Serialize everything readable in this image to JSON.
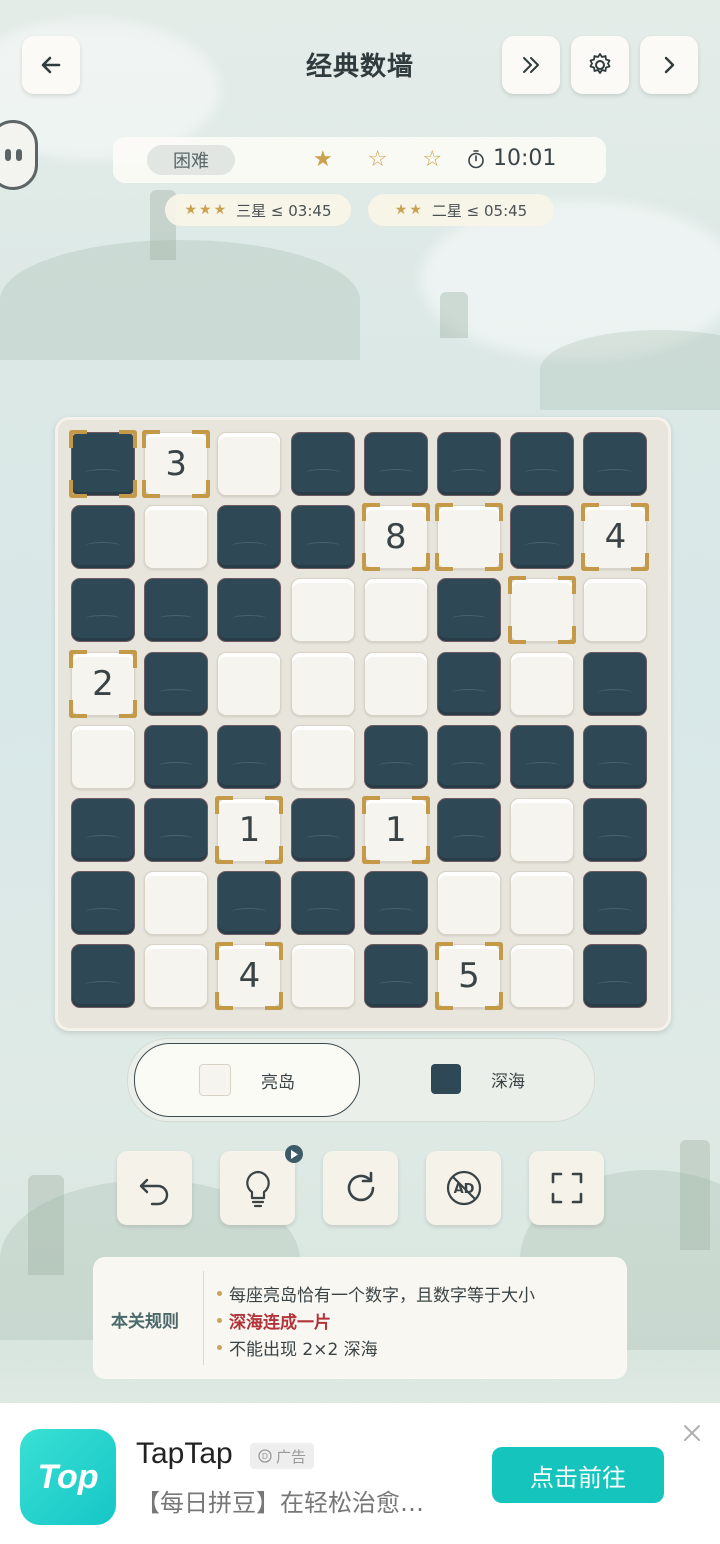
{
  "header": {
    "title": "经典数墙",
    "back_icon": "arrow-left-icon",
    "skip_icon": "double-chevron-right-icon",
    "settings_icon": "gear-icon",
    "next_icon": "chevron-right-icon"
  },
  "status": {
    "difficulty": "困难",
    "stars_display": "★ ☆ ☆",
    "stars_earned": 1,
    "stars_total": 3,
    "timer": "10:01"
  },
  "goals": [
    {
      "stars": "★★★",
      "label": "三星 ≤ 03:45"
    },
    {
      "stars": "★★",
      "label": "二星 ≤ 05:45"
    }
  ],
  "board": {
    "size": 8,
    "rows": [
      [
        "D",
        "3",
        "L",
        "D",
        "D",
        "D",
        "D",
        "D"
      ],
      [
        "D",
        "L",
        "D",
        "D",
        "8",
        "L",
        "D",
        "4"
      ],
      [
        "D",
        "D",
        "D",
        "L",
        "L",
        "D",
        "L",
        "L"
      ],
      [
        "2",
        "D",
        "L",
        "L",
        "L",
        "D",
        "L",
        "D"
      ],
      [
        "L",
        "D",
        "D",
        "L",
        "D",
        "D",
        "D",
        "D"
      ],
      [
        "D",
        "D",
        "1",
        "D",
        "1",
        "D",
        "L",
        "D"
      ],
      [
        "D",
        "L",
        "D",
        "D",
        "D",
        "L",
        "L",
        "D"
      ],
      [
        "D",
        "L",
        "4",
        "L",
        "D",
        "5",
        "L",
        "D"
      ]
    ],
    "highlighted": [
      [
        0,
        0
      ],
      [
        0,
        1
      ],
      [
        1,
        4
      ],
      [
        1,
        5
      ],
      [
        1,
        7
      ],
      [
        2,
        6
      ],
      [
        3,
        0
      ],
      [
        5,
        2
      ],
      [
        5,
        4
      ],
      [
        7,
        2
      ],
      [
        7,
        5
      ]
    ],
    "colors": {
      "dark": "#2f4855",
      "light": "#f6f4ee",
      "highlight": "#c49a49"
    }
  },
  "modes": {
    "light": {
      "label": "亮岛",
      "color": "#f6f4ee",
      "active": true
    },
    "dark": {
      "label": "深海",
      "color": "#2f4855",
      "active": false
    }
  },
  "tools": [
    {
      "name": "undo-icon"
    },
    {
      "name": "hint-bulb-icon",
      "badge": "play-icon"
    },
    {
      "name": "restart-icon"
    },
    {
      "name": "no-ads-icon"
    },
    {
      "name": "fullscreen-icon"
    }
  ],
  "rules": {
    "title": "本关规则",
    "items": [
      {
        "text": "每座亮岛恰有一个数字，且数字等于大小",
        "emphasis": false
      },
      {
        "text": "深海连成一片",
        "emphasis": true
      },
      {
        "text": "不能出现 2×2 深海",
        "emphasis": false
      }
    ]
  },
  "ad": {
    "app_name": "TapTap",
    "logo_text": "Top",
    "tag": "广告",
    "description": "【每日拼豆】在轻松治愈…",
    "cta": "点击前往",
    "accent": "#15c5bd"
  }
}
